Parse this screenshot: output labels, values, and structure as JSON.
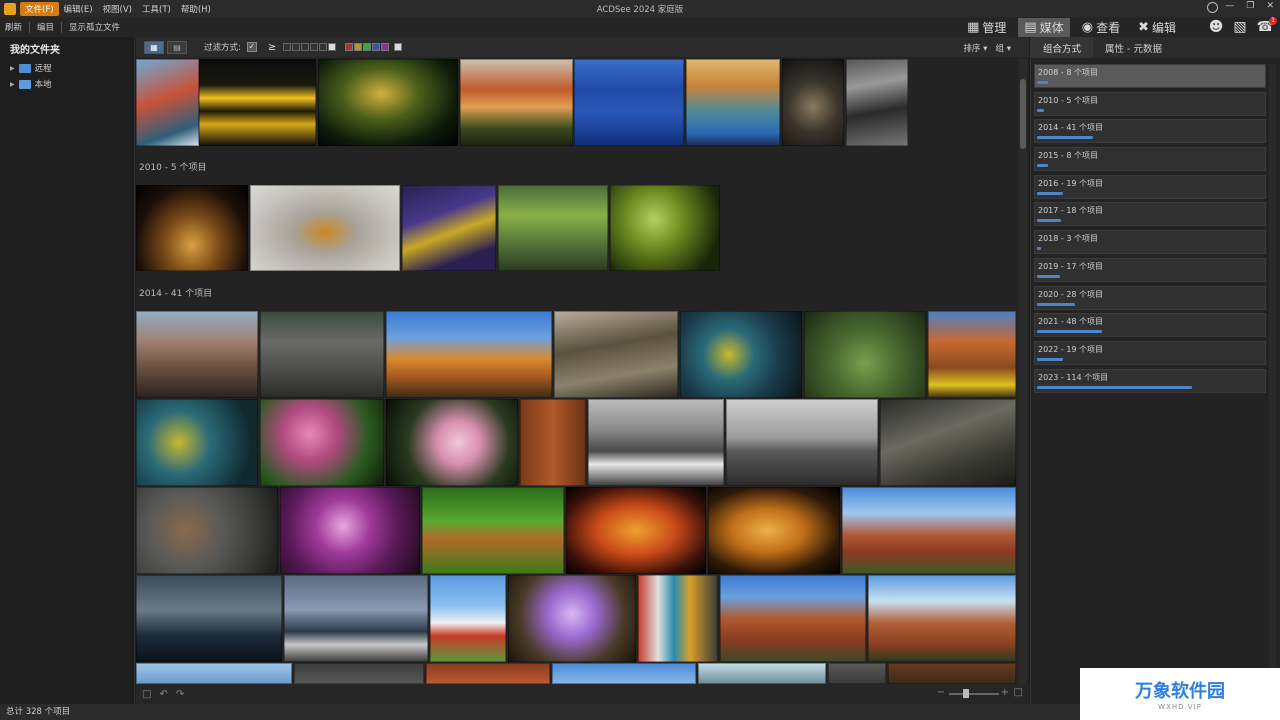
{
  "menubar": {
    "items": [
      "文件(F)",
      "编辑(E)",
      "视图(V)",
      "工具(T)",
      "帮助(H)"
    ],
    "active_index": 0,
    "title": "ACDSee 2024 家庭版",
    "window_buttons": [
      "—",
      "❐",
      "✕"
    ]
  },
  "toolbar": {
    "items": [
      "刷新",
      "编目",
      "显示孤立文件"
    ]
  },
  "modes": [
    {
      "label": "管理",
      "icon": "grid-icon",
      "active": false
    },
    {
      "label": "媒体",
      "icon": "media-icon",
      "active": true
    },
    {
      "label": "查看",
      "icon": "eye-icon",
      "active": false
    },
    {
      "label": "编辑",
      "icon": "edit-icon",
      "active": false
    }
  ],
  "left_panel": {
    "title": "我的文件夹",
    "items": [
      {
        "label": "远程",
        "icon": "cloud-folder-icon"
      },
      {
        "label": "本地",
        "icon": "computer-icon"
      }
    ]
  },
  "filterbar": {
    "filter_label": "过滤方式:",
    "gte_symbol": "≥",
    "sort_label": "排序",
    "group_label": "组"
  },
  "groups": [
    {
      "label": "2010 - 5 个项目"
    },
    {
      "label": "2014 - 41 个项目"
    }
  ],
  "right_panel": {
    "tabs": [
      "组合方式",
      "属性 - 元数据"
    ],
    "active_tab": 0,
    "items": [
      {
        "label": "2008 - 8 个项目",
        "count": 8,
        "selected": true
      },
      {
        "label": "2010 - 5 个项目",
        "count": 5,
        "selected": false
      },
      {
        "label": "2014 - 41 个项目",
        "count": 41,
        "selected": false
      },
      {
        "label": "2015 - 8 个项目",
        "count": 8,
        "selected": false
      },
      {
        "label": "2016 - 19 个项目",
        "count": 19,
        "selected": false
      },
      {
        "label": "2017 - 18 个项目",
        "count": 18,
        "selected": false
      },
      {
        "label": "2018 - 3 个项目",
        "count": 3,
        "selected": false
      },
      {
        "label": "2019 - 17 个项目",
        "count": 17,
        "selected": false
      },
      {
        "label": "2020 - 28 个项目",
        "count": 28,
        "selected": false
      },
      {
        "label": "2021 - 48 个项目",
        "count": 48,
        "selected": false
      },
      {
        "label": "2022 - 19 个项目",
        "count": 19,
        "selected": false
      },
      {
        "label": "2023 - 114 个项目",
        "count": 114,
        "selected": false
      }
    ]
  },
  "status": {
    "total": "总计 328 个项目"
  },
  "watermark": {
    "logo": "万象软件园",
    "sub": "WXHD.VIP"
  },
  "colors": {
    "accent": "#d67a14",
    "bar": "#4a86c8",
    "selected": "#5a5a5a"
  }
}
